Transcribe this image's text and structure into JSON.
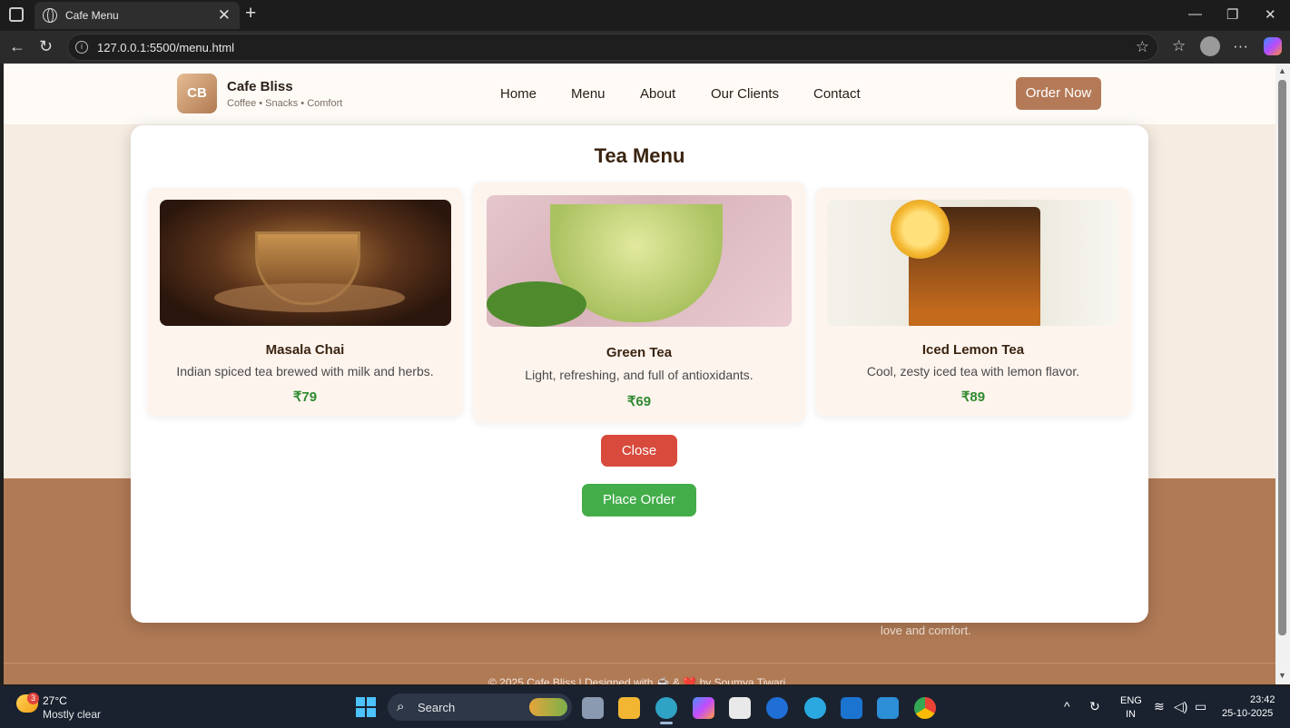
{
  "browser": {
    "tab_title": "Cafe Menu",
    "url": "127.0.0.1:5500/menu.html"
  },
  "site": {
    "logo_initials": "CB",
    "brand_name": "Cafe Bliss",
    "tagline": "Coffee • Snacks • Comfort",
    "nav": [
      "Home",
      "Menu",
      "About",
      "Our Clients",
      "Contact"
    ],
    "cta": "Order Now",
    "bg_text_partial": "love and comfort.",
    "footer_partial": "© 2025 Cafe Bliss | Designed with ☕ & ❤️ by Soumya Tiwari"
  },
  "modal": {
    "title": "Tea Menu",
    "items": [
      {
        "name": "Masala Chai",
        "desc": "Indian spiced tea brewed with milk and herbs.",
        "price": "₹79",
        "image": "masala-chai-image"
      },
      {
        "name": "Green Tea",
        "desc": "Light, refreshing, and full of antioxidants.",
        "price": "₹69",
        "image": "green-tea-image"
      },
      {
        "name": "Iced Lemon Tea",
        "desc": "Cool, zesty iced tea with lemon flavor.",
        "price": "₹89",
        "image": "iced-lemon-tea-image"
      }
    ],
    "close_label": "Close",
    "order_label": "Place Order"
  },
  "taskbar": {
    "temperature": "27°C",
    "condition": "Mostly clear",
    "weather_badge": "3",
    "search_label": "Search",
    "lang_top": "ENG",
    "lang_bottom": "IN",
    "time": "23:42",
    "date": "25-10-2025"
  },
  "colors": {
    "accent_brown": "#b47a57",
    "close_red": "#d84a3c",
    "order_green": "#43ad4a",
    "price_green": "#2f8a2f"
  }
}
